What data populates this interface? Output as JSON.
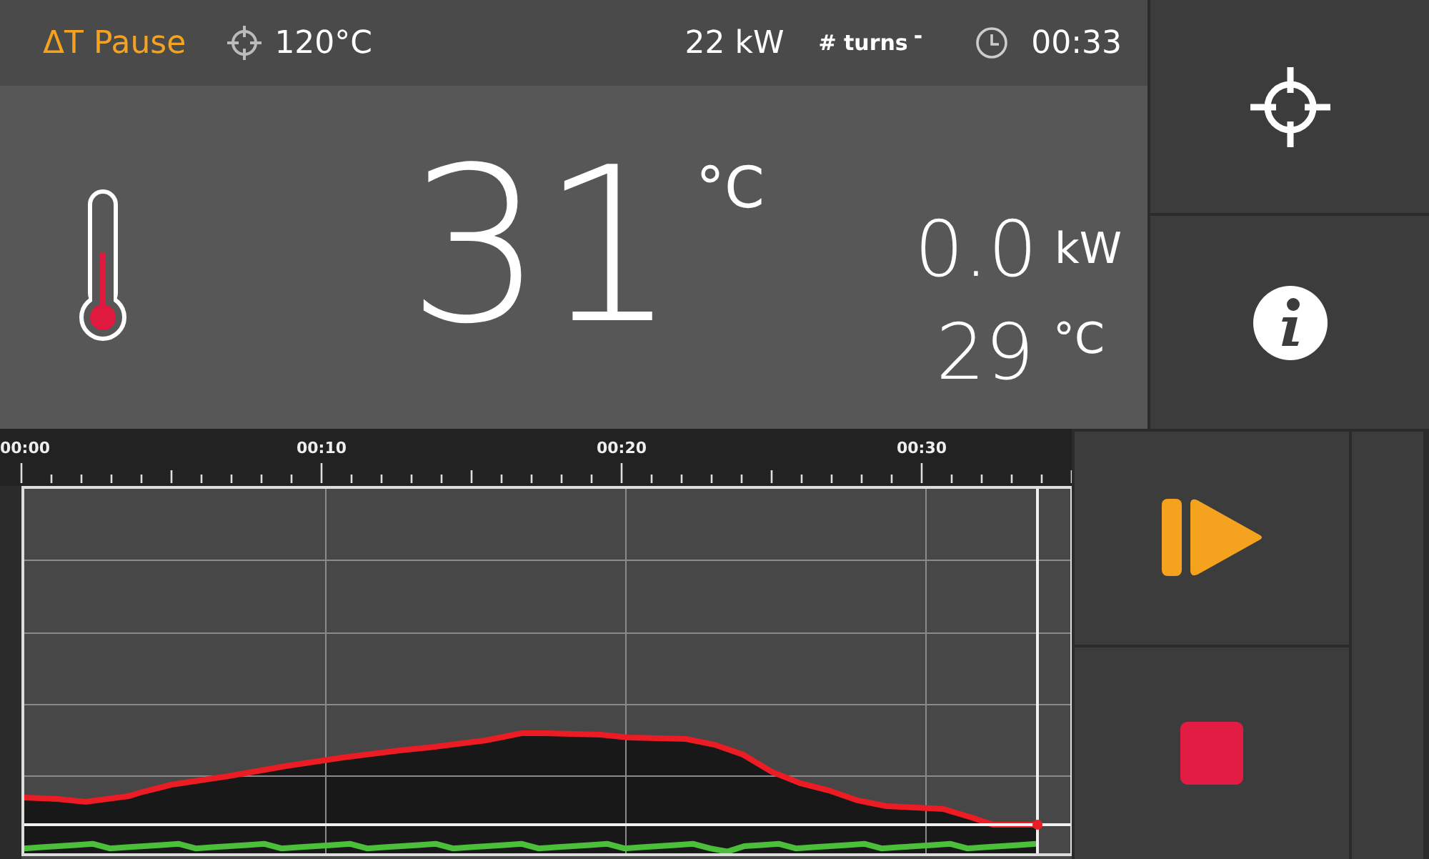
{
  "status_bar": {
    "mode": "ΔT Pause",
    "target_temperature": "120°C",
    "power": "22 kW",
    "turns_label": "# turns",
    "turns_value": "-",
    "time": "00:33"
  },
  "readout": {
    "temperature": "31",
    "temperature_unit": "°C",
    "power": "0.0",
    "power_unit": "kW",
    "second_temperature": "29",
    "second_temperature_unit": "°C"
  },
  "timeline": {
    "labels": [
      "00:00",
      "00:10",
      "00:20",
      "00:30"
    ]
  },
  "side_controls": [
    {
      "kind": "target"
    },
    {
      "kind": "info"
    }
  ],
  "playback_controls": [
    {
      "kind": "resume"
    },
    {
      "kind": "stop"
    }
  ]
}
